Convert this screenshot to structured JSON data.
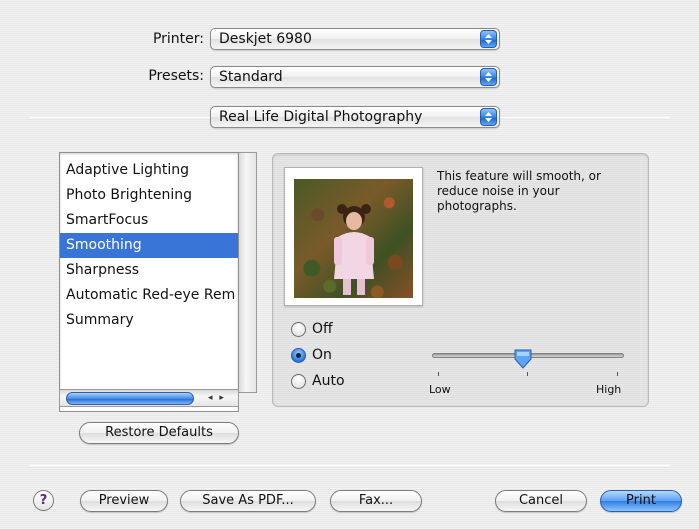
{
  "printer": {
    "label": "Printer:",
    "value": "Deskjet 6980"
  },
  "presets": {
    "label": "Presets:",
    "value": "Standard"
  },
  "section_popup": {
    "value": "Real Life Digital Photography"
  },
  "features_list": {
    "items": [
      {
        "label": "Adaptive Lighting",
        "selected": false
      },
      {
        "label": "Photo Brightening",
        "selected": false
      },
      {
        "label": "SmartFocus",
        "selected": false
      },
      {
        "label": "Smoothing",
        "selected": true
      },
      {
        "label": "Sharpness",
        "selected": false
      },
      {
        "label": "Automatic Red-eye Rem",
        "selected": false
      },
      {
        "label": "Summary",
        "selected": false
      }
    ]
  },
  "restore_defaults": "Restore Defaults",
  "detail": {
    "description": "This feature will smooth, or reduce noise in your photographs.",
    "options": [
      {
        "label": "Off",
        "checked": false
      },
      {
        "label": "On",
        "checked": true
      },
      {
        "label": "Auto",
        "checked": false
      }
    ],
    "slider": {
      "low_label": "Low",
      "high_label": "High",
      "level": 0.5
    }
  },
  "footer": {
    "help": "?",
    "preview": "Preview",
    "save_pdf": "Save As PDF...",
    "fax": "Fax...",
    "cancel": "Cancel",
    "print": "Print"
  },
  "colors": {
    "accent": "#3875d7",
    "default_button": "#2f7fe0"
  }
}
